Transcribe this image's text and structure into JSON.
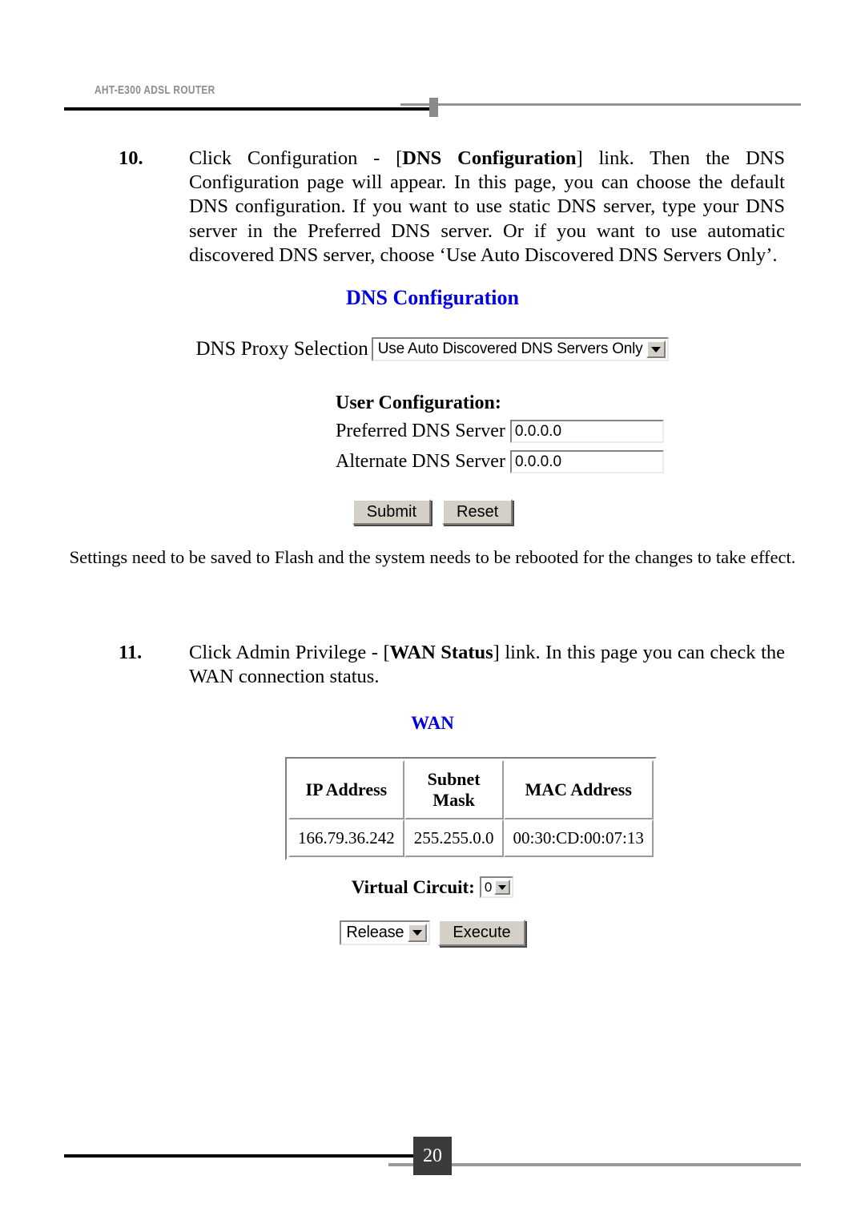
{
  "header": {
    "title": "AHT-E300 ADSL ROUTER"
  },
  "steps": [
    {
      "number": "10.",
      "text_before": "Click Configuration - [",
      "bold": "DNS Configuration",
      "text_after": "] link. Then the DNS Configuration page will appear. In this page, you can choose the default DNS configuration. If you want to use static DNS server, type your DNS server in the Preferred DNS server. Or if you want to use automatic discovered DNS server, choose ‘Use Auto Discovered DNS Servers Only’."
    },
    {
      "number": "11.",
      "text_before": "Click Admin Privilege - [",
      "bold": "WAN Status",
      "text_after": "] link. In this page you can check the WAN connection status."
    }
  ],
  "dns_panel": {
    "title": "DNS Configuration",
    "title_color": "#0000e0",
    "proxy_label": "DNS Proxy Selection",
    "proxy_value": "Use Auto Discovered DNS Servers Only",
    "proxy_options": [
      "Use Auto Discovered DNS Servers Only"
    ],
    "user_config_heading": "User Configuration:",
    "preferred_label": "Preferred DNS Server",
    "preferred_value": "0.0.0.0",
    "alternate_label": "Alternate DNS Server",
    "alternate_value": "0.0.0.0",
    "submit_label": "Submit",
    "reset_label": "Reset",
    "note": "Settings need to be saved to Flash and the system needs to be rebooted for the changes to take effect."
  },
  "wan_panel": {
    "title": "WAN",
    "title_color": "#0000e0",
    "table": {
      "columns": [
        "IP Address",
        "Subnet Mask",
        "MAC Address"
      ],
      "rows": [
        [
          "166.79.36.242",
          "255.255.0.0",
          "00:30:CD:00:07:13"
        ]
      ]
    },
    "virtual_circuit_label": "Virtual Circuit:",
    "virtual_circuit_value": "0",
    "virtual_circuit_options": [
      "0"
    ],
    "action_value": "Release",
    "action_options": [
      "Release"
    ],
    "execute_label": "Execute"
  },
  "footer": {
    "page_number": "20"
  }
}
